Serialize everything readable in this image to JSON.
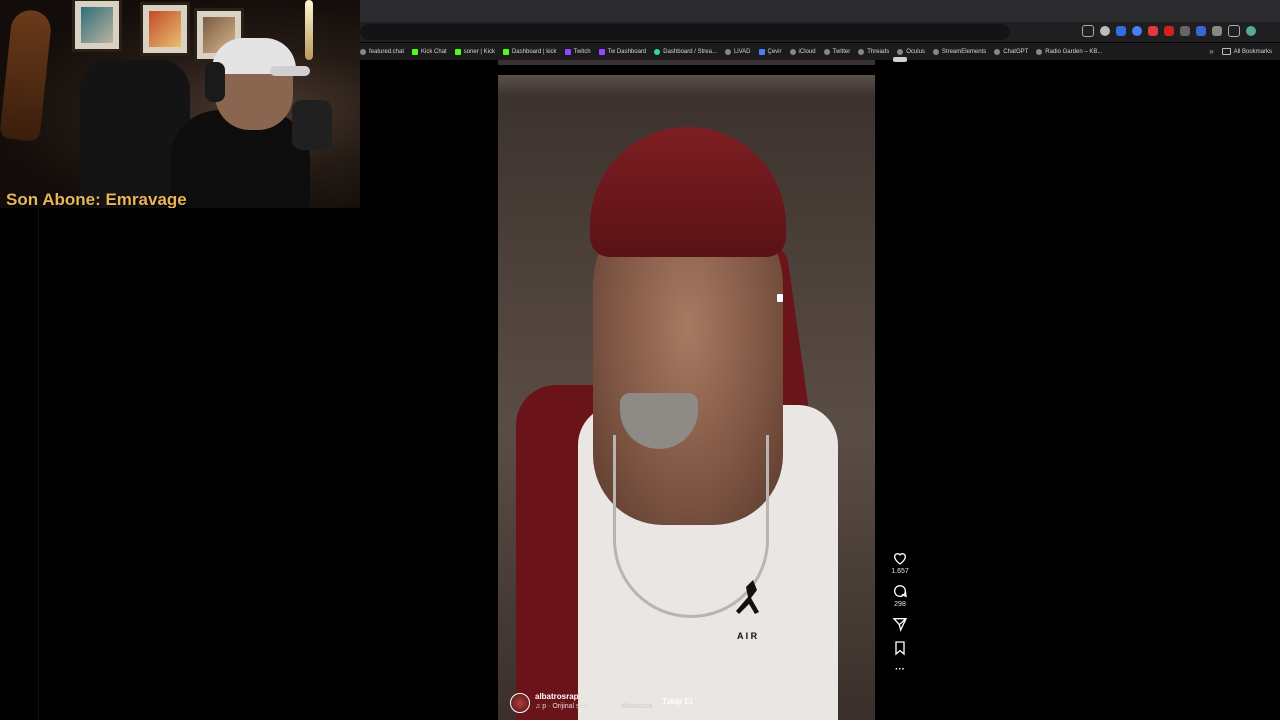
{
  "bookmarks": {
    "items": [
      {
        "label": "featured.chat",
        "kind": "globe"
      },
      {
        "label": "Kick Chat",
        "kind": "kick"
      },
      {
        "label": "soner | Kick",
        "kind": "kick"
      },
      {
        "label": "Dashboard | kick",
        "kind": "kick"
      },
      {
        "label": "Twitch",
        "kind": "twitch"
      },
      {
        "label": "Tw Dashboard",
        "kind": "twitch"
      },
      {
        "label": "Dashboard / Strea...",
        "kind": "se"
      },
      {
        "label": "LiVAD",
        "kind": "globe"
      },
      {
        "label": "Çevir",
        "kind": "globe"
      },
      {
        "label": "iCloud",
        "kind": "globe"
      },
      {
        "label": "Twitter",
        "kind": "globe"
      },
      {
        "label": "Threads",
        "kind": "globe"
      },
      {
        "label": "Oculus",
        "kind": "globe"
      },
      {
        "label": "StreamElements",
        "kind": "globe"
      },
      {
        "label": "ChatGPT",
        "kind": "globe"
      },
      {
        "label": "Radio Garden – KB...",
        "kind": "globe"
      }
    ],
    "more": "»",
    "all_label": "All Bookmarks"
  },
  "overlay": {
    "subscriber_text": "Son Abone: Emravage"
  },
  "reel": {
    "likes": "1.657",
    "comments": "298",
    "username": "albatrosrap",
    "audio": "p · Orijinal ses",
    "audio_secondary": "albatrosra",
    "follow_label": "Takip Et",
    "more": "···"
  }
}
